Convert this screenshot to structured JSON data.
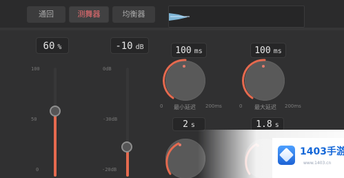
{
  "tabs": [
    {
      "label": "通回",
      "active": false
    },
    {
      "label": "测舞器",
      "active": true
    },
    {
      "label": "均衡器",
      "active": false
    }
  ],
  "sliders": [
    {
      "value": "60",
      "unit": "%",
      "level": 0.6,
      "ticks": [
        "100",
        "50",
        "0"
      ]
    },
    {
      "value": "-10",
      "unit": "dB",
      "level": 0.27,
      "ticks": [
        "0dB",
        "-30dB",
        "-20dB"
      ]
    }
  ],
  "knobs": {
    "top": [
      {
        "value": "100",
        "unit": "ms",
        "label": "最小延迟",
        "range_min": "0",
        "range_max": "200ms",
        "level": 0.5
      },
      {
        "value": "100",
        "unit": "ms",
        "label": "最大延迟",
        "range_min": "0",
        "range_max": "200ms",
        "level": 0.5
      }
    ],
    "bottom": [
      {
        "value": "2",
        "unit": "s",
        "level": 0.42
      },
      {
        "value": "1.8",
        "unit": "s",
        "level": 0.36
      }
    ]
  },
  "colors": {
    "accent": "#e56a4f",
    "active_tab": "#ef6f73",
    "background": "#303031"
  },
  "watermark": {
    "title": "1403手游网",
    "url": "www.1403.cn"
  }
}
